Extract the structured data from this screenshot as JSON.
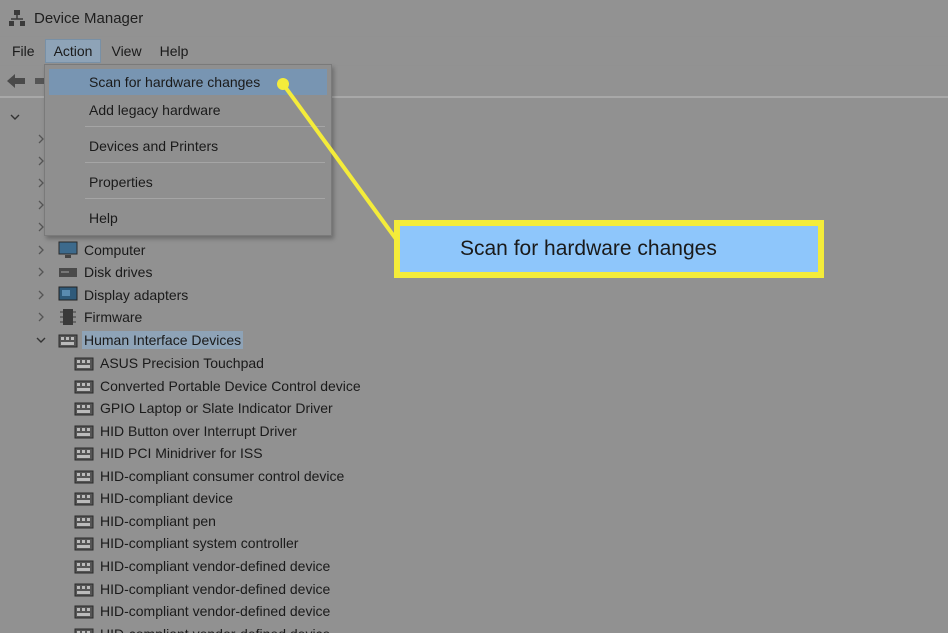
{
  "window": {
    "title": "Device Manager"
  },
  "menubar": {
    "items": [
      "File",
      "Action",
      "View",
      "Help"
    ],
    "active": "Action"
  },
  "action_menu": {
    "items": [
      "Scan for hardware changes",
      "Add legacy hardware",
      "Devices and Printers",
      "Properties",
      "Help"
    ],
    "highlighted": "Scan for hardware changes"
  },
  "callout": {
    "text": "Scan for hardware changes",
    "highlight_color": "#f4ec3a",
    "fill_color": "#8ec6fb"
  },
  "tree": {
    "categories": [
      "Computer",
      "Disk drives",
      "Display adapters",
      "Firmware",
      "Human Interface Devices"
    ],
    "expanded_category": "Human Interface Devices",
    "hid_children": [
      "ASUS Precision Touchpad",
      "Converted Portable Device Control device",
      "GPIO Laptop or Slate Indicator Driver",
      "HID Button over Interrupt Driver",
      "HID PCI Minidriver for ISS",
      "HID-compliant consumer control device",
      "HID-compliant device",
      "HID-compliant pen",
      "HID-compliant system controller",
      "HID-compliant vendor-defined device",
      "HID-compliant vendor-defined device",
      "HID-compliant vendor-defined device",
      "HID-compliant vendor-defined device"
    ]
  },
  "icons": {
    "app": "device-manager-icon",
    "back": "back-arrow-icon",
    "computer": "monitor-icon",
    "disk": "disk-drive-icon",
    "display": "display-adapter-icon",
    "firmware": "chip-icon",
    "hid": "hid-device-icon"
  }
}
